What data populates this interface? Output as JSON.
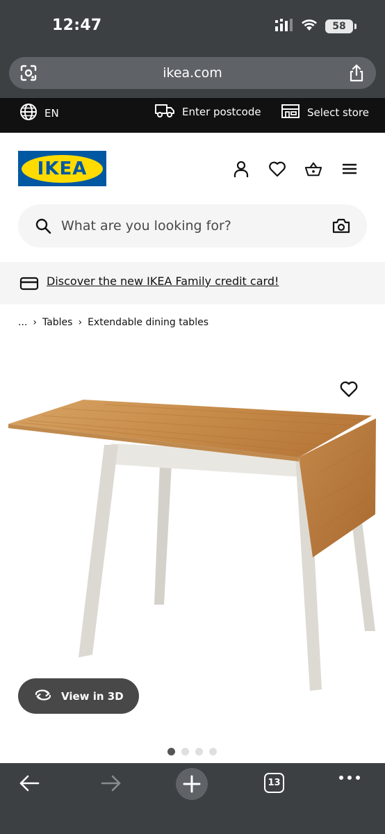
{
  "status_bar": {
    "time": "12:47",
    "battery": "58"
  },
  "browser": {
    "url": "ikea.com",
    "open_tabs": "13"
  },
  "top_strip": {
    "language": "EN",
    "postcode": "Enter postcode",
    "store": "Select store"
  },
  "header": {
    "logo_text": "IKEA",
    "brand_blue": "#0058a3",
    "brand_yellow": "#ffdb00",
    "icons": [
      "person-icon",
      "heart-icon",
      "basket-icon",
      "menu-icon"
    ]
  },
  "search": {
    "placeholder": "What are you looking for?"
  },
  "promo": {
    "text": "Discover the new IKEA Family credit card!"
  },
  "breadcrumb": {
    "ellipsis": "...",
    "items": [
      "Tables",
      "Extendable dining tables"
    ]
  },
  "product": {
    "view3d_label": "View in 3D",
    "image_count": 4,
    "active_image": 1
  }
}
